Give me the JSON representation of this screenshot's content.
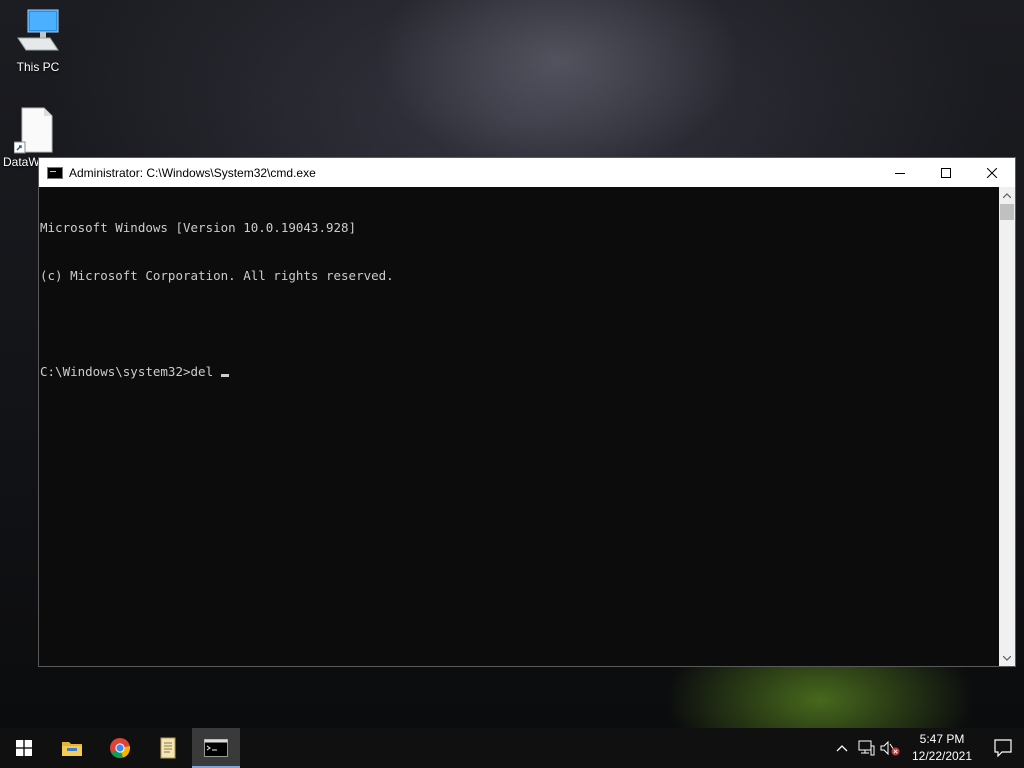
{
  "desktop": {
    "icons": [
      {
        "label": "This PC",
        "icon": "computer-icon"
      },
      {
        "label": "DataW",
        "icon": "file-shortcut-icon"
      }
    ]
  },
  "window": {
    "title": "Administrator: C:\\Windows\\System32\\cmd.exe",
    "console_lines": [
      "Microsoft Windows [Version 10.0.19043.928]",
      "(c) Microsoft Corporation. All rights reserved.",
      "",
      "C:\\Windows\\system32>del "
    ]
  },
  "taskbar": {
    "items": [
      {
        "name": "start",
        "icon": "windows-logo-icon"
      },
      {
        "name": "file-explorer",
        "icon": "folder-icon"
      },
      {
        "name": "chrome",
        "icon": "chrome-icon"
      },
      {
        "name": "notepad",
        "icon": "scroll-icon"
      },
      {
        "name": "cmd",
        "icon": "terminal-icon",
        "active": true
      }
    ],
    "clock": {
      "time": "5:47 PM",
      "date": "12/22/2021"
    }
  }
}
